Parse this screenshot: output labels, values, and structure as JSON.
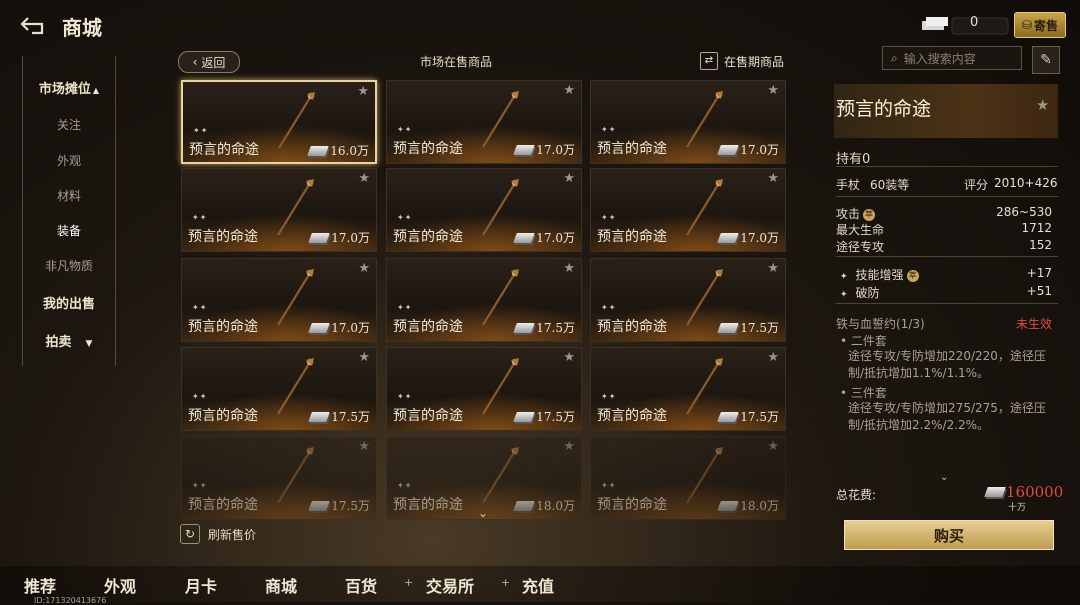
{
  "header": {
    "title": "商城",
    "currency_value": "0",
    "consign_label": "寄售"
  },
  "sidebar": {
    "groups": [
      {
        "label": "市场摊位",
        "caret": "▲"
      },
      {
        "label": "关注"
      },
      {
        "label": "外观"
      },
      {
        "label": "材料"
      },
      {
        "label": "装备"
      },
      {
        "label": "非凡物质"
      },
      {
        "label": "我的出售"
      },
      {
        "label": "拍卖",
        "caret": "▼"
      }
    ],
    "selected": "装备"
  },
  "market": {
    "back_label": "返回",
    "title": "市场在售商品",
    "onsale_label": "在售期商品",
    "refresh_label": "刷新售价",
    "items": [
      {
        "name": "预言的命途",
        "price": "16.0万",
        "selected": true
      },
      {
        "name": "预言的命途",
        "price": "17.0万"
      },
      {
        "name": "预言的命途",
        "price": "17.0万"
      },
      {
        "name": "预言的命途",
        "price": "17.0万"
      },
      {
        "name": "预言的命途",
        "price": "17.0万"
      },
      {
        "name": "预言的命途",
        "price": "17.0万"
      },
      {
        "name": "预言的命途",
        "price": "17.0万"
      },
      {
        "name": "预言的命途",
        "price": "17.5万"
      },
      {
        "name": "预言的命途",
        "price": "17.5万"
      },
      {
        "name": "预言的命途",
        "price": "17.5万"
      },
      {
        "name": "预言的命途",
        "price": "17.5万"
      },
      {
        "name": "预言的命途",
        "price": "17.5万"
      },
      {
        "name": "预言的命途",
        "price": "17.5万"
      },
      {
        "name": "预言的命途",
        "price": "18.0万"
      },
      {
        "name": "预言的命途",
        "price": "18.0万"
      }
    ]
  },
  "detail": {
    "search_placeholder": "输入搜索内容",
    "item_name": "预言的命途",
    "owned": "持有0",
    "type": "手杖",
    "level": "60装等",
    "score_label": "评分",
    "score": "2010+426",
    "stats": [
      {
        "label": "攻击",
        "badge": "萃",
        "value": "286~530"
      },
      {
        "label": "最大生命",
        "value": "1712"
      },
      {
        "label": "途径专攻",
        "value": "152"
      }
    ],
    "bonus": [
      {
        "label": "技能增强",
        "badge": "萃",
        "value": "+17"
      },
      {
        "label": "破防",
        "value": "+51"
      }
    ],
    "set_name": "铁与血誓约(1/3)",
    "set_status": "未生效",
    "set_two_label": "二件套",
    "set_two_text": "途径专攻/专防增加220/220，途径压制/抵抗增加1.1%/1.1%。",
    "set_three_label": "三件套",
    "set_three_text": "途径专攻/专防增加275/275，途径压制/抵抗增加2.2%/2.2%。",
    "total_label": "总花费:",
    "total_value": "160000",
    "total_unit": "十万",
    "buy_label": "购买"
  },
  "bottom_nav": [
    "推荐",
    "外观",
    "月卡",
    "商城",
    "百货",
    "交易所",
    "充值"
  ],
  "device_id": "ID:171320413676",
  "colors": {
    "accent_gold": "#c9a45a",
    "price_red": "#e24b3a"
  }
}
